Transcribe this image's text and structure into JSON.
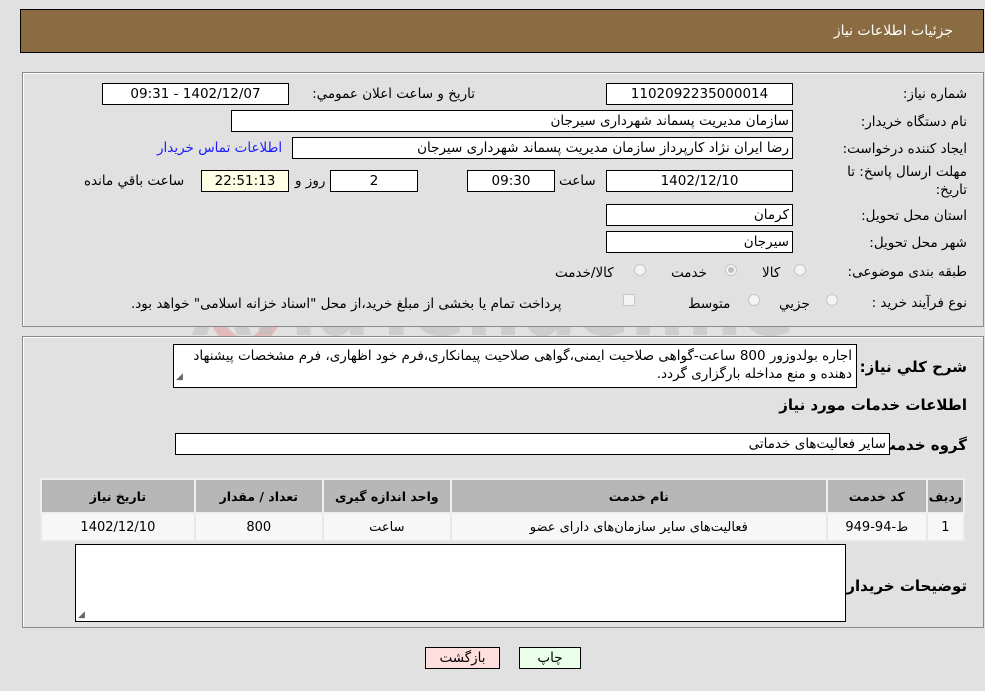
{
  "header": {
    "title": "جزئیات اطلاعات نیاز"
  },
  "form": {
    "need_number": {
      "label": "شماره نیاز:",
      "value": "1102092235000014"
    },
    "announce_datetime": {
      "label": "تاریخ و ساعت اعلان عمومي:",
      "value": "1402/12/07 - 09:31"
    },
    "buyer_org": {
      "label": "نام دستگاه خریدار:",
      "value": "سازمان مدیریت پسماند شهرداری سیرجان"
    },
    "requester": {
      "label": "ایجاد کننده درخواست:",
      "value": "رضا ایران نژاد کارپرداز سازمان مدیریت پسماند شهرداری سیرجان"
    },
    "contact_link": "اطلاعات تماس خریدار",
    "deadline": {
      "label_line1": "مهلت ارسال پاسخ: تا",
      "label_line2": "تاریخ:",
      "date": "1402/12/10",
      "time_label": "ساعت",
      "time": "09:30",
      "days": "2",
      "days_label": "روز و",
      "remaining": "22:51:13",
      "remaining_label": "ساعت باقي مانده"
    },
    "province": {
      "label": "استان محل تحویل:",
      "value": "کرمان"
    },
    "city": {
      "label": "شهر محل تحویل:",
      "value": "سیرجان"
    },
    "category": {
      "label": "طبقه بندی موضوعی:",
      "options": [
        "کالا",
        "خدمت",
        "کالا/خدمت"
      ],
      "selected": "خدمت"
    },
    "purchase_type": {
      "label": "نوع فرآیند خرید :",
      "options": [
        "جزيي",
        "متوسط"
      ],
      "payment_note": "پرداخت تمام یا بخشی از مبلغ خرید،از محل \"اسناد خزانه اسلامی\" خواهد بود."
    }
  },
  "details": {
    "description_label": "شرح کلي نیاز:",
    "description": "اجاره بولدوزور 800 ساعت-گواهی صلاحیت ایمنی،گواهی صلاحیت پیمانکاری،فرم خود اظهاری، فرم مشخصات پیشنهاد دهنده و منع مداخله بارگزاری گردد.",
    "services_heading": "اطلاعات خدمات مورد نیاز",
    "service_group_label": "گروه خدمت:",
    "service_group": "سایر فعالیت‌های خدماتی",
    "table": {
      "headers": [
        "ردیف",
        "کد خدمت",
        "نام خدمت",
        "واحد اندازه گیری",
        "تعداد / مقدار",
        "تاریخ نیاز"
      ],
      "rows": [
        [
          "1",
          "ط-94-949",
          "فعالیت‌های سایر سازمان‌های دارای عضو",
          "ساعت",
          "800",
          "1402/12/10"
        ]
      ]
    },
    "buyer_notes_label": "توضیحات خریدار:",
    "buyer_notes": ""
  },
  "buttons": {
    "print": "چاپ",
    "back": "بازگشت"
  },
  "watermark": "AriaTender.neT",
  "colors": {
    "header_bg": "#8b6b42",
    "link": "#1a1aff",
    "print_btn": "#eaffea",
    "back_btn": "#ffdede",
    "remaining_bg": "#ffffe6"
  }
}
